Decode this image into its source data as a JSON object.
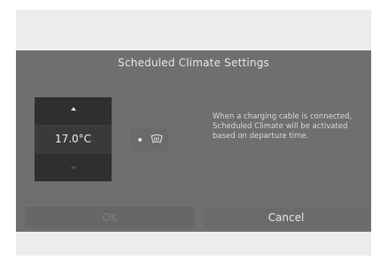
{
  "dialog": {
    "title": "Scheduled Climate Settings",
    "temperature": {
      "value": "17.0°C",
      "up_icon": "triangle-up-icon",
      "down_icon": "triangle-down-icon"
    },
    "defrost": {
      "icon": "front-defrost-icon",
      "indicator_on": true
    },
    "info_text": "When a charging cable is connected, Scheduled Climate will be activated based on departure time.",
    "buttons": {
      "ok_label": "OK",
      "cancel_label": "Cancel"
    }
  }
}
